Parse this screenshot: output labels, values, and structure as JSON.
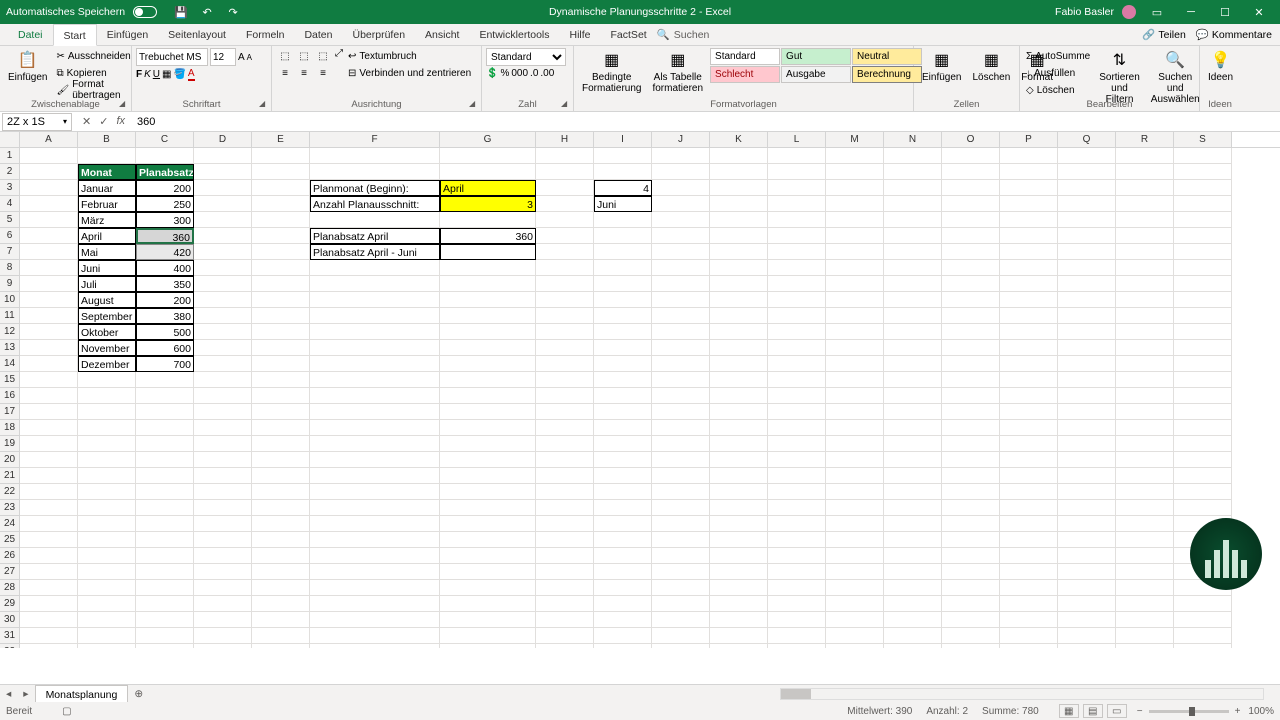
{
  "titlebar": {
    "autosave": "Automatisches Speichern",
    "doc_title": "Dynamische Planungsschritte 2 - Excel",
    "user": "Fabio Basler"
  },
  "tabs": {
    "file": "Datei",
    "items": [
      "Start",
      "Einfügen",
      "Seitenlayout",
      "Formeln",
      "Daten",
      "Überprüfen",
      "Ansicht",
      "Entwicklertools",
      "Hilfe",
      "FactSet"
    ],
    "search_placeholder": "Suchen",
    "share": "Teilen",
    "comments": "Kommentare"
  },
  "ribbon": {
    "clipboard": {
      "paste": "Einfügen",
      "cut": "Ausschneiden",
      "copy": "Kopieren",
      "format_painter": "Format übertragen",
      "label": "Zwischenablage"
    },
    "font": {
      "name": "Trebuchet MS",
      "size": "12",
      "label": "Schriftart"
    },
    "alignment": {
      "wrap": "Textumbruch",
      "merge": "Verbinden und zentrieren",
      "label": "Ausrichtung"
    },
    "number": {
      "format": "Standard",
      "label": "Zahl"
    },
    "styles": {
      "cond": "Bedingte\nFormatierung",
      "as_table": "Als Tabelle\nformatieren",
      "standard": "Standard",
      "gut": "Gut",
      "neutral": "Neutral",
      "schlecht": "Schlecht",
      "ausgabe": "Ausgabe",
      "berechnung": "Berechnung",
      "label": "Formatvorlagen"
    },
    "cells": {
      "insert": "Einfügen",
      "delete": "Löschen",
      "format": "Format",
      "label": "Zellen"
    },
    "editing": {
      "sum": "AutoSumme",
      "fill": "Ausfüllen",
      "clear": "Löschen",
      "sort": "Sortieren und\nFiltern",
      "find": "Suchen und\nAuswählen",
      "label": "Bearbeiten"
    },
    "ideas": {
      "label": "Ideen"
    }
  },
  "namebox": "2Z x 1S",
  "formula": "360",
  "columns": [
    "A",
    "B",
    "C",
    "D",
    "E",
    "F",
    "G",
    "H",
    "I",
    "J",
    "K",
    "L",
    "M",
    "N",
    "O",
    "P",
    "Q",
    "R",
    "S"
  ],
  "table": {
    "header_month": "Monat",
    "header_value": "Planabsatz",
    "rows": [
      {
        "m": "Januar",
        "v": "200"
      },
      {
        "m": "Februar",
        "v": "250"
      },
      {
        "m": "März",
        "v": "300"
      },
      {
        "m": "April",
        "v": "360"
      },
      {
        "m": "Mai",
        "v": "420"
      },
      {
        "m": "Juni",
        "v": "400"
      },
      {
        "m": "Juli",
        "v": "350"
      },
      {
        "m": "August",
        "v": "200"
      },
      {
        "m": "September",
        "v": "380"
      },
      {
        "m": "Oktober",
        "v": "500"
      },
      {
        "m": "November",
        "v": "600"
      },
      {
        "m": "Dezember",
        "v": "700"
      }
    ]
  },
  "side": {
    "planmonat_label": "Planmonat (Beginn):",
    "planmonat_value": "April",
    "anzahl_label": "Anzahl Planausschnitt:",
    "anzahl_value": "3",
    "i3": "4",
    "i4": "Juni",
    "absatz_label": "Planabsatz April",
    "absatz_value": "360",
    "range_label": "Planabsatz April - Juni"
  },
  "sheet": {
    "name": "Monatsplanung"
  },
  "status": {
    "ready": "Bereit",
    "avg_label": "Mittelwert:",
    "avg": "390",
    "count_label": "Anzahl:",
    "count": "2",
    "sum_label": "Summe:",
    "sum": "780",
    "zoom": "100%"
  }
}
